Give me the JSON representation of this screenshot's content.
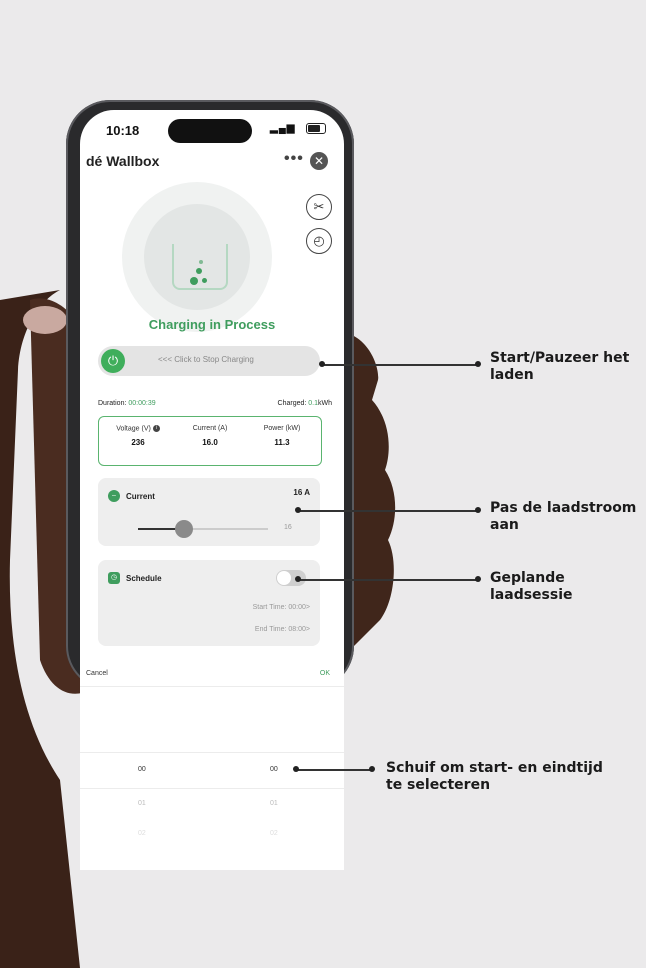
{
  "status_bar": {
    "time": "10:18"
  },
  "app": {
    "title": "dé Wallbox",
    "more_label": "•••",
    "close_label": "✕"
  },
  "icons": {
    "settings": "tools-icon",
    "timer": "timer-icon",
    "power": "power-icon"
  },
  "charging": {
    "status": "Charging in Process",
    "stop_hint": "<<< Click to Stop Charging",
    "duration_label": "Duration:",
    "duration_value": "00:00:39",
    "charged_label": "Charged:",
    "charged_value": "0.1",
    "charged_unit": "kWh"
  },
  "metrics": {
    "voltage_label": "Voltage (V)",
    "voltage_value": "236",
    "current_label": "Current (A)",
    "current_value": "16.0",
    "power_label": "Power (kW)",
    "power_value": "11.3"
  },
  "current_card": {
    "label": "Current",
    "value": "16 A",
    "slider_end": "16",
    "level_fraction": 0.35
  },
  "schedule_card": {
    "label": "Schedule",
    "enabled": false,
    "start_time": "Start Time: 00:00>",
    "end_time": "End Time: 08:00>"
  },
  "picker": {
    "cancel": "Cancel",
    "ok": "OK",
    "selected_left": "00",
    "selected_right": "00",
    "next_left": "01",
    "next_right": "01",
    "after_left": "02",
    "after_right": "02"
  },
  "callouts": {
    "start_pause": "Start/Pauzeer het laden",
    "adjust_current": "Pas de laadstroom aan",
    "scheduled": "Geplande laadsessie",
    "slide_time": "Schuif om start- en eindtijd te selecteren"
  },
  "colors": {
    "accent_green": "#3f9d5e",
    "background": "#ebeaeb"
  }
}
